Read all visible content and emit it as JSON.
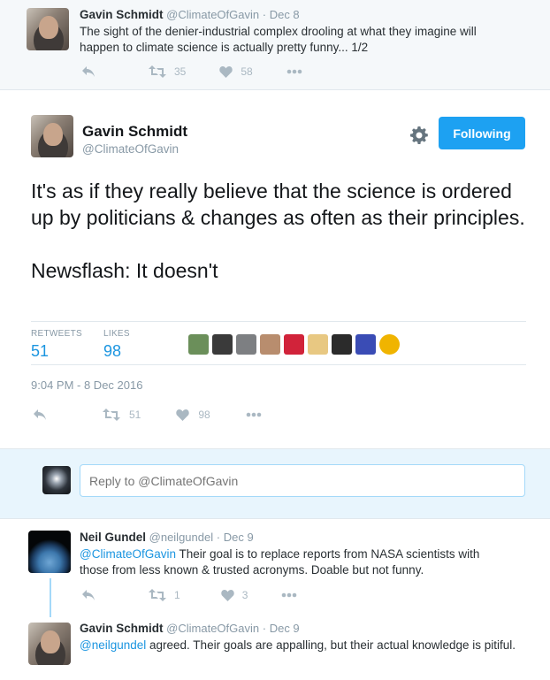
{
  "context_tweet": {
    "name": "Gavin Schmidt",
    "handle": "@ClimateOfGavin",
    "separator": "·",
    "date": "Dec 8",
    "text": "The sight of the denier-industrial complex drooling at what they imagine will happen to climate science is actually pretty funny... 1/2",
    "retweets": "35",
    "likes": "58"
  },
  "main_tweet": {
    "name": "Gavin Schmidt",
    "handle": "@ClimateOfGavin",
    "follow_label": "Following",
    "text_p1": "It's as if they really believe that the science is ordered up by politicians & changes as often as their principles.",
    "text_p2": "Newsflash: It doesn't",
    "retweets_label": "RETWEETS",
    "retweets_count": "51",
    "likes_label": "LIKES",
    "likes_count": "98",
    "timestamp": "9:04 PM - 8 Dec 2016",
    "action_retweets": "51",
    "action_likes": "98",
    "liker_colors": [
      "#6b8f5a",
      "#3a3a3a",
      "#7d7f82",
      "#b88d6e",
      "#d1233a",
      "#e8c882",
      "#2b2b2b",
      "#3a4cb5",
      "#f0b400"
    ]
  },
  "reply_box": {
    "placeholder": "Reply to @ClimateOfGavin"
  },
  "replies": [
    {
      "name": "Neil Gundel",
      "handle": "@neilgundel",
      "separator": "·",
      "date": "Dec 9",
      "mention": "@ClimateOfGavin",
      "text": " Their goal is to replace reports from NASA scientists with those from less known & trusted acronyms. Doable but not funny.",
      "retweets": "1",
      "likes": "3"
    },
    {
      "name": "Gavin Schmidt",
      "handle": "@ClimateOfGavin",
      "separator": "·",
      "date": "Dec 9",
      "mention": "@neilgundel",
      "text": " agreed. Their goals are appalling, but their actual knowledge is pitiful."
    }
  ]
}
